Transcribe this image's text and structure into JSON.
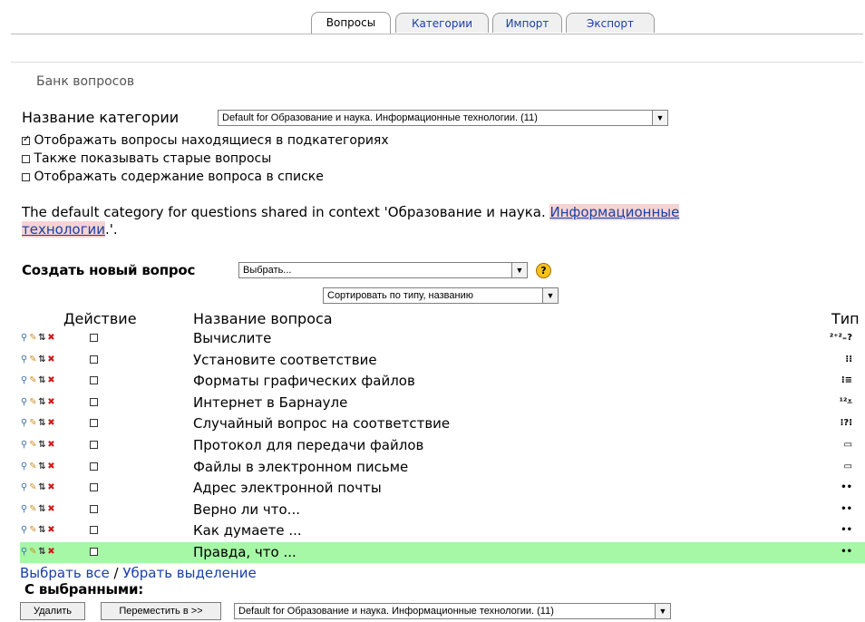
{
  "tabs": [
    "Вопросы",
    "Категории",
    "Импорт",
    "Экспорт"
  ],
  "page_heading": "Банк вопросов",
  "category": {
    "label": "Название категории",
    "selected": "Default for Образование и наука. Информационные технологии. (11)"
  },
  "options": [
    {
      "label": "Отображать вопросы находящиеся в подкатегориях",
      "checked": true
    },
    {
      "label": "Также показывать старые вопросы",
      "checked": false
    },
    {
      "label": "Отображать содержание вопроса в списке",
      "checked": false
    }
  ],
  "info": {
    "before": "The default category for questions shared in context 'Образование и наука. ",
    "link_line1": "Информационные",
    "link_line2": "технологии",
    "after": ".'."
  },
  "create": {
    "label": "Создать новый вопрос",
    "selected": "Выбрать...",
    "help_glyph": "?"
  },
  "sort": {
    "selected": "Сортировать по типу, названию"
  },
  "table": {
    "headers": {
      "action": "Действие",
      "name": "Название вопроса",
      "type": "Тип"
    },
    "rows": [
      {
        "name": "Вычислите",
        "type_icon": "calculated-icon",
        "type_glyph": "²⁺²₌?",
        "highlight": false
      },
      {
        "name": "Установите соответствие",
        "type_icon": "matching-icon",
        "type_glyph": "⁝⁝",
        "highlight": false
      },
      {
        "name": "Форматы графических файлов",
        "type_icon": "multichoice-icon",
        "type_glyph": "⁝≡",
        "highlight": false
      },
      {
        "name": "Интернет в Барнауле",
        "type_icon": "numerical-icon",
        "type_glyph": "¹²⩡",
        "highlight": false
      },
      {
        "name": "Случайный вопрос на соответствие",
        "type_icon": "random-match-icon",
        "type_glyph": "⁝?⁝",
        "highlight": false
      },
      {
        "name": "Протокол для передачи файлов",
        "type_icon": "shortanswer-icon",
        "type_glyph": "▭",
        "highlight": false
      },
      {
        "name": "Файлы в электронном письме",
        "type_icon": "shortanswer-icon",
        "type_glyph": "▭",
        "highlight": false
      },
      {
        "name": "Адрес электронной почты",
        "type_icon": "truefalse-icon",
        "type_glyph": "••",
        "highlight": false
      },
      {
        "name": "Верно ли что...",
        "type_icon": "truefalse-icon",
        "type_glyph": "••",
        "highlight": false
      },
      {
        "name": "Как думаете ...",
        "type_icon": "truefalse-icon",
        "type_glyph": "••",
        "highlight": false
      },
      {
        "name": "Правда, что ...",
        "type_icon": "truefalse-icon",
        "type_glyph": "••",
        "highlight": true
      }
    ]
  },
  "select_all": "Выбрать все",
  "separator": " / ",
  "deselect": "Убрать выделение",
  "with_selected": "С выбранными:",
  "delete_button": "Удалить",
  "move_button": "Переместить в >>",
  "move_target": "Default for Образование и наука. Информационные технологии. (11)",
  "colors": {
    "highlight_row": "#a6f7a6",
    "link": "#1a3fa8",
    "link_bg": "#f6d3d3"
  }
}
